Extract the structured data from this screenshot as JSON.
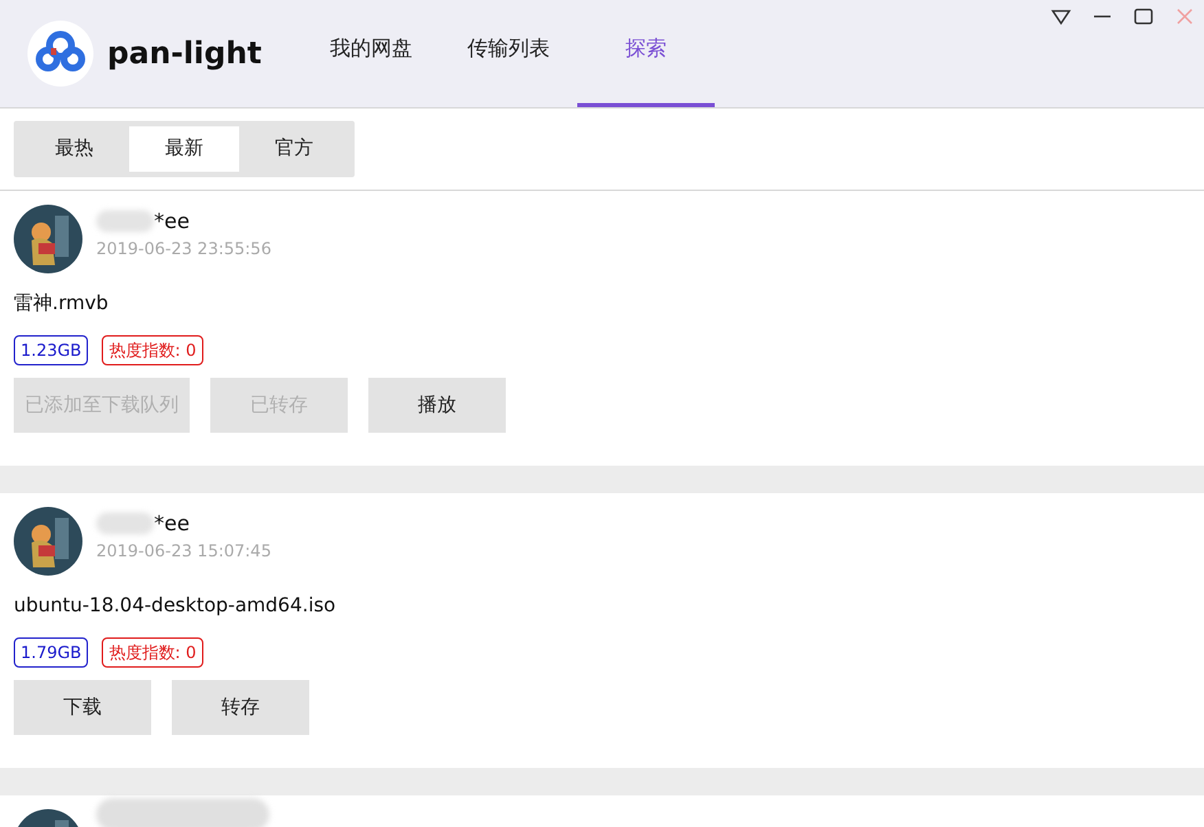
{
  "app": {
    "name": "pan-light"
  },
  "nav_tabs": [
    {
      "label": "我的网盘",
      "selected": false
    },
    {
      "label": "传输列表",
      "selected": false
    },
    {
      "label": "探索",
      "selected": true
    }
  ],
  "window_controls": [
    {
      "kind": "dropdown"
    },
    {
      "kind": "minimize"
    },
    {
      "kind": "maximize"
    },
    {
      "kind": "close"
    }
  ],
  "filter_tabs": [
    {
      "label": "最热",
      "selected": false
    },
    {
      "label": "最新",
      "selected": true
    },
    {
      "label": "官方",
      "selected": false
    }
  ],
  "shares": [
    {
      "user": "*ee",
      "time": "2019-06-23 23:55:56",
      "file": "雷神.rmvb",
      "size": "1.23GB",
      "heat": "热度指数: 0",
      "buttons": [
        {
          "label": "已添加至下载队列",
          "disabled": true
        },
        {
          "label": "已转存",
          "disabled": true
        },
        {
          "label": "播放",
          "disabled": false
        }
      ]
    },
    {
      "user": "*ee",
      "time": "2019-06-23 15:07:45",
      "file": "ubuntu-18.04-desktop-amd64.iso",
      "size": "1.79GB",
      "heat": "热度指数: 0",
      "buttons": [
        {
          "label": "下载",
          "disabled": false
        },
        {
          "label": "转存",
          "disabled": false
        }
      ]
    }
  ]
}
